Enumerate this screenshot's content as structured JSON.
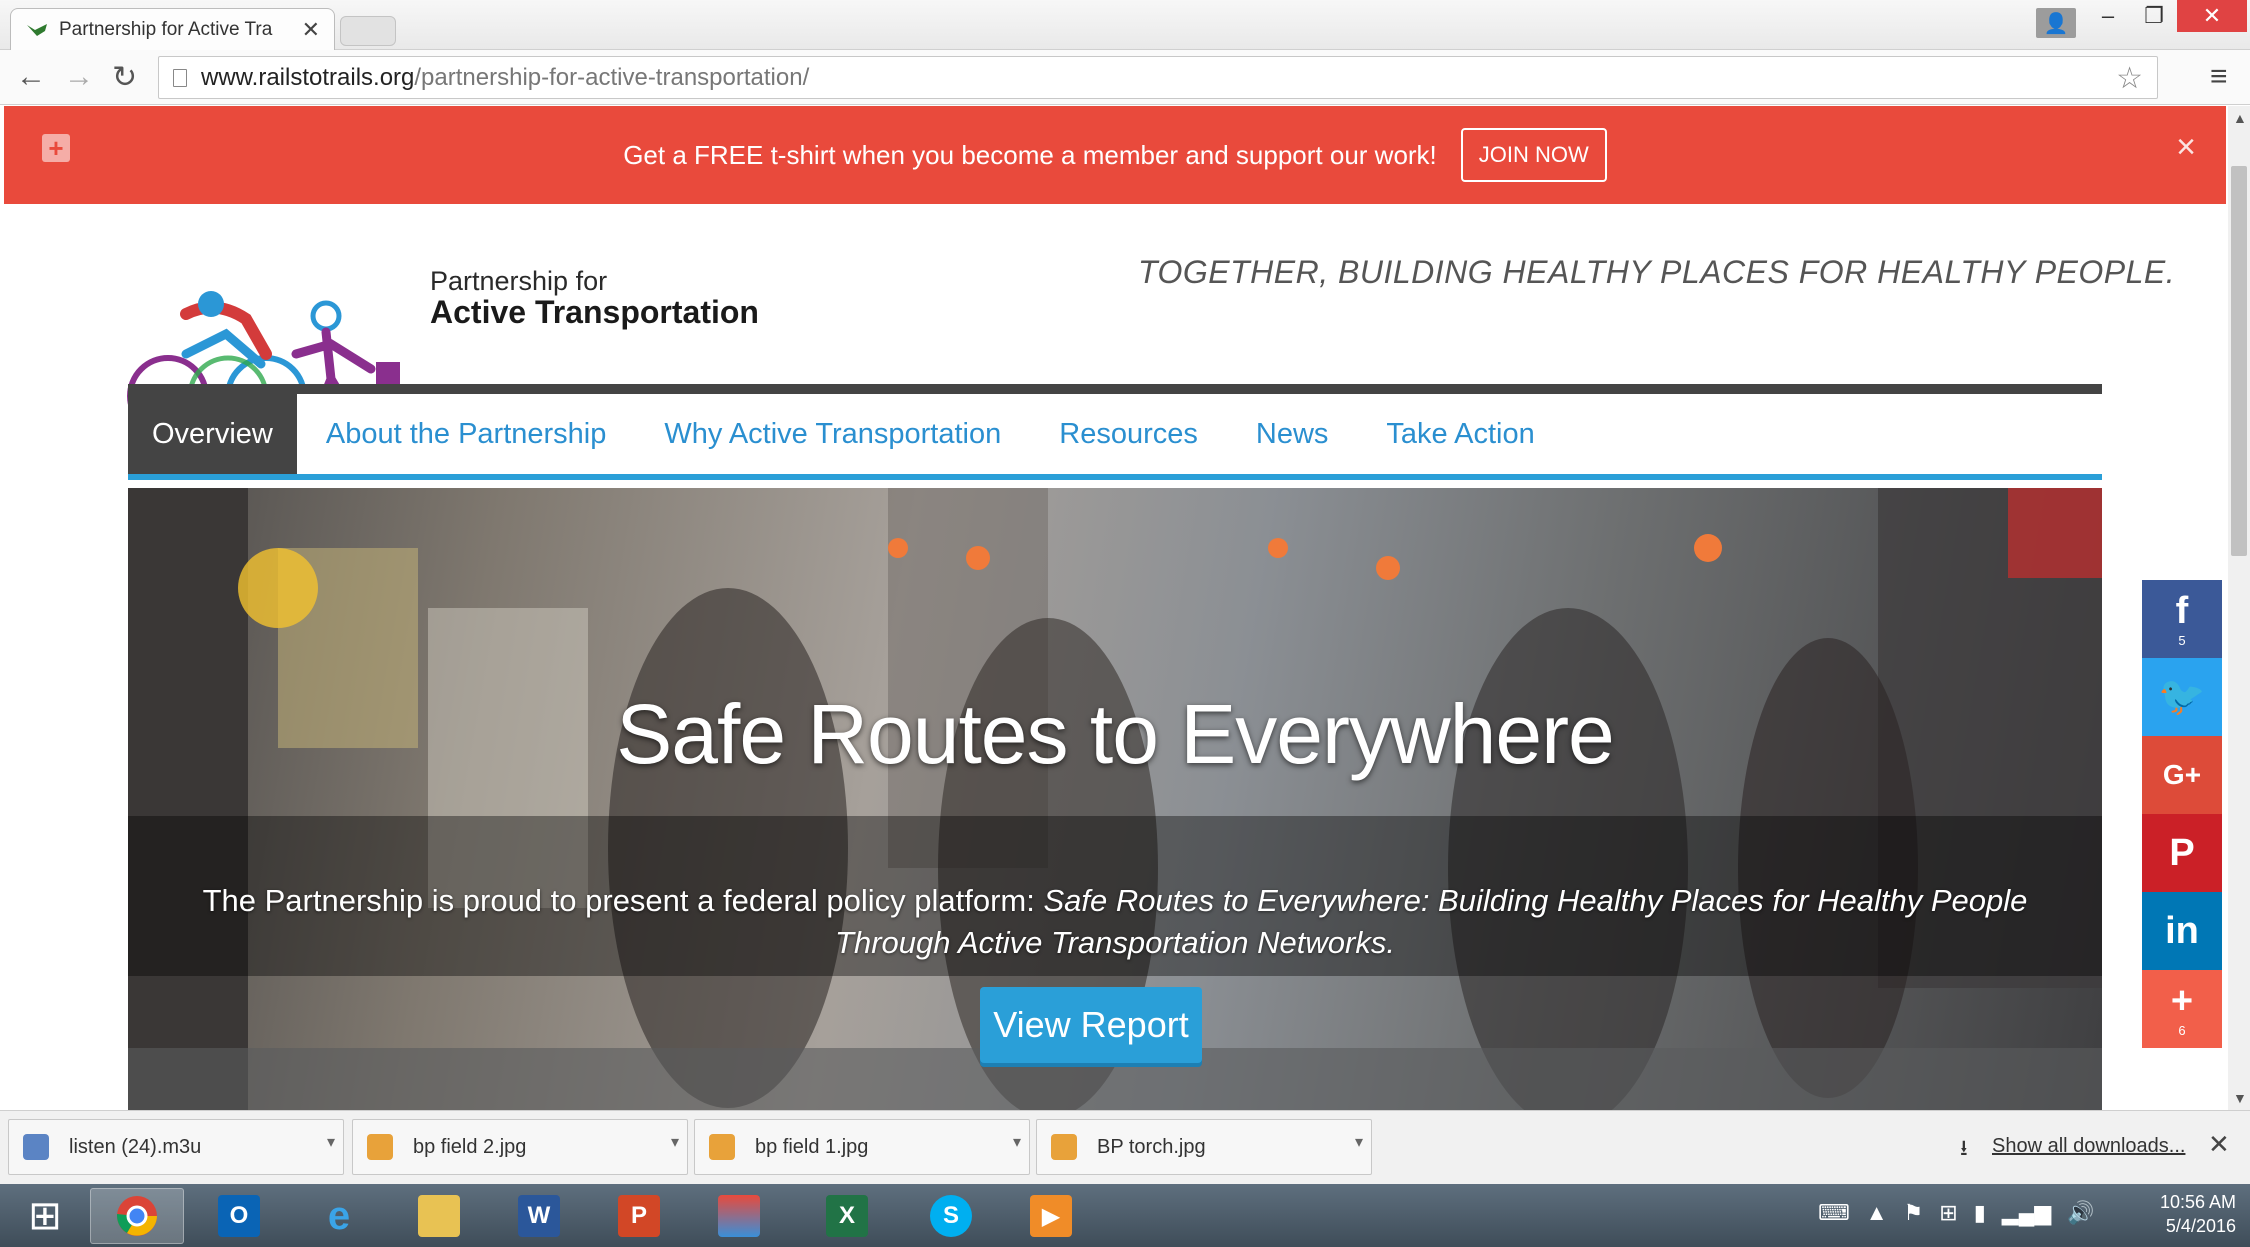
{
  "browser": {
    "tab_title": "Partnership for Active Tra",
    "url_host": "www.railstotrails.org",
    "url_path": "/partnership-for-active-transportation/"
  },
  "promo": {
    "text": "Get a FREE t-shirt when you become a member and support our work!",
    "cta": "JOIN NOW",
    "close": "×",
    "color": "#e94a3c"
  },
  "header": {
    "logo_line1": "Partnership for",
    "logo_line2": "Active Transportation",
    "tagline": "TOGETHER, BUILDING HEALTHY PLACES FOR HEALTHY PEOPLE."
  },
  "nav": {
    "items": [
      {
        "label": "Overview",
        "active": true
      },
      {
        "label": "About the Partnership"
      },
      {
        "label": "Why Active Transportation"
      },
      {
        "label": "Resources"
      },
      {
        "label": "News"
      },
      {
        "label": "Take Action"
      }
    ],
    "accent": "#2a9fd8"
  },
  "hero": {
    "title": "Safe Routes to Everywhere",
    "desc_plain": "The Partnership is proud to present a federal policy platform: ",
    "desc_em": "Safe Routes to Everywhere: Building Healthy Places for Healthy People Through Active Transportation Networks.",
    "button": "View Report"
  },
  "social": {
    "facebook": {
      "icon": "f",
      "count": "5"
    },
    "twitter": {
      "icon": "🐦"
    },
    "googleplus": {
      "icon": "G+"
    },
    "pinterest": {
      "icon": "P"
    },
    "linkedin": {
      "icon": "in"
    },
    "share": {
      "icon": "+",
      "count": "6"
    }
  },
  "downloads": {
    "items": [
      {
        "name": "listen (24).m3u"
      },
      {
        "name": "bp field 2.jpg"
      },
      {
        "name": "bp field 1.jpg"
      },
      {
        "name": "BP torch.jpg"
      }
    ],
    "show_all": "Show all downloads..."
  },
  "taskbar": {
    "time": "10:56 AM",
    "date": "5/4/2016"
  }
}
